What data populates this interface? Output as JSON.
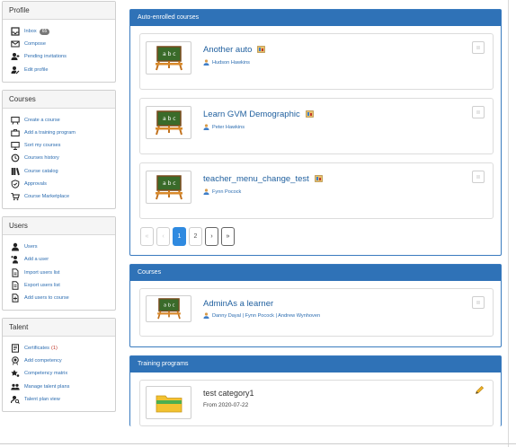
{
  "sidebar": {
    "profile": {
      "title": "Profile",
      "items": [
        {
          "label": "Inbox",
          "badge": "65",
          "icon": "inbox-icon"
        },
        {
          "label": "Compose",
          "icon": "envelope-icon"
        },
        {
          "label": "Pending invitations",
          "icon": "user-plus-icon"
        },
        {
          "label": "Edit profile",
          "icon": "user-edit-icon"
        }
      ]
    },
    "courses": {
      "title": "Courses",
      "items": [
        {
          "label": "Create a course",
          "icon": "create-course-icon"
        },
        {
          "label": "Add a training program",
          "icon": "briefcase-icon"
        },
        {
          "label": "Sort my courses",
          "icon": "sort-icon"
        },
        {
          "label": "Courses history",
          "icon": "history-icon"
        },
        {
          "label": "Course catalog",
          "icon": "books-icon"
        },
        {
          "label": "Approvals",
          "icon": "approvals-icon"
        },
        {
          "label": "Course Marketplace",
          "icon": "cart-icon"
        }
      ]
    },
    "users": {
      "title": "Users",
      "items": [
        {
          "label": "Users",
          "icon": "user-icon"
        },
        {
          "label": "Add a user",
          "icon": "add-user-icon"
        },
        {
          "label": "Import users list",
          "icon": "import-icon"
        },
        {
          "label": "Export users list",
          "icon": "export-icon"
        },
        {
          "label": "Add users to course",
          "icon": "add-to-course-icon"
        }
      ]
    },
    "talent": {
      "title": "Talent",
      "items": [
        {
          "label": "Certificates",
          "count": "(1)",
          "icon": "certificate-icon"
        },
        {
          "label": "Add competency",
          "icon": "award-icon"
        },
        {
          "label": "Competency matrix",
          "icon": "matrix-icon"
        },
        {
          "label": "Manage talent plans",
          "icon": "group-icon"
        },
        {
          "label": "Talent plan view",
          "icon": "plan-view-icon"
        }
      ]
    }
  },
  "auto_enrolled": {
    "title": "Auto-enrolled courses",
    "courses": [
      {
        "title": "Another auto",
        "teachers": "Hudson Hawkins"
      },
      {
        "title": "Learn GVM Demographic",
        "teachers": "Peter Hawkins"
      },
      {
        "title": "teacher_menu_change_test",
        "teachers": "Fynn Pocock"
      }
    ],
    "pager": {
      "first": "«",
      "prev": "‹",
      "page1": "1",
      "page2": "2",
      "next": "›",
      "last": "»"
    }
  },
  "courses_panel": {
    "title": "Courses",
    "courses": [
      {
        "title": "AdminAs a learner",
        "teachers": "Danny Dayal | Fynn Pocock | Andrew Wynhoven"
      }
    ]
  },
  "training_programs": {
    "title": "Training programs",
    "items": [
      {
        "title": "test category1",
        "date": "From 2020-07-22"
      }
    ]
  },
  "colors": {
    "panel_header": "#2f72b7",
    "link": "#2b6cb0",
    "active_page": "#2f8ae0"
  }
}
